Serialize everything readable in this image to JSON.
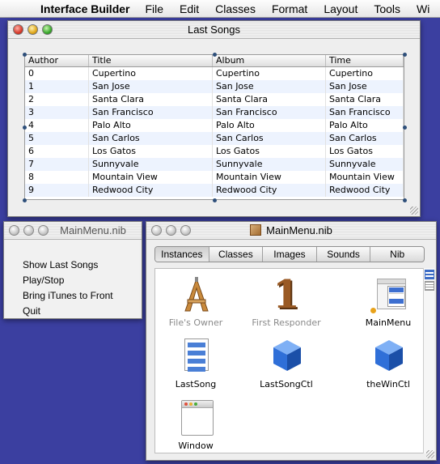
{
  "menubar": {
    "app_name": "Interface Builder",
    "menus": [
      "File",
      "Edit",
      "Classes",
      "Format",
      "Layout",
      "Tools",
      "Wi"
    ]
  },
  "songs_window": {
    "title": "Last Songs",
    "columns": [
      "Author",
      "Title",
      "Album",
      "Time"
    ],
    "rows": [
      [
        "0",
        "Cupertino",
        "Cupertino",
        "Cupertino"
      ],
      [
        "1",
        "San Jose",
        "San Jose",
        "San Jose"
      ],
      [
        "2",
        "Santa Clara",
        "Santa Clara",
        "Santa Clara"
      ],
      [
        "3",
        "San Francisco",
        "San Francisco",
        "San Francisco"
      ],
      [
        "4",
        "Palo Alto",
        "Palo Alto",
        "Palo Alto"
      ],
      [
        "5",
        "San Carlos",
        "San Carlos",
        "San Carlos"
      ],
      [
        "6",
        "Los Gatos",
        "Los Gatos",
        "Los Gatos"
      ],
      [
        "7",
        "Sunnyvale",
        "Sunnyvale",
        "Sunnyvale"
      ],
      [
        "8",
        "Mountain View",
        "Mountain View",
        "Mountain View"
      ],
      [
        "9",
        "Redwood City",
        "Redwood City",
        "Redwood City"
      ]
    ]
  },
  "menu_window": {
    "title": "MainMenu.nib",
    "items": [
      "Show Last Songs",
      "Play/Stop",
      "Bring iTunes to Front",
      "Quit"
    ]
  },
  "nib_window": {
    "title": "MainMenu.nib",
    "tabs": [
      "Instances",
      "Classes",
      "Images",
      "Sounds",
      "Nib"
    ],
    "active_tab": "Instances",
    "items": [
      {
        "label": "File's Owner",
        "icon": "files-owner-icon",
        "dim": true
      },
      {
        "label": "First Responder",
        "icon": "first-responder-icon",
        "dim": true
      },
      {
        "label": "MainMenu",
        "icon": "main-menu-icon",
        "dim": false
      },
      {
        "label": "LastSong",
        "icon": "table-doc-icon",
        "dim": false
      },
      {
        "label": "LastSongCtl",
        "icon": "blue-cube-icon",
        "dim": false
      },
      {
        "label": "theWinCtl",
        "icon": "blue-cube-icon",
        "dim": false
      },
      {
        "label": "Window",
        "icon": "window-icon",
        "dim": false
      }
    ]
  },
  "colors": {
    "desktop": "#3b3fa0",
    "row_stripe": "#edf3fe",
    "selection_handle": "#2e4f7a",
    "cube_blue": "#2f6fd8"
  }
}
